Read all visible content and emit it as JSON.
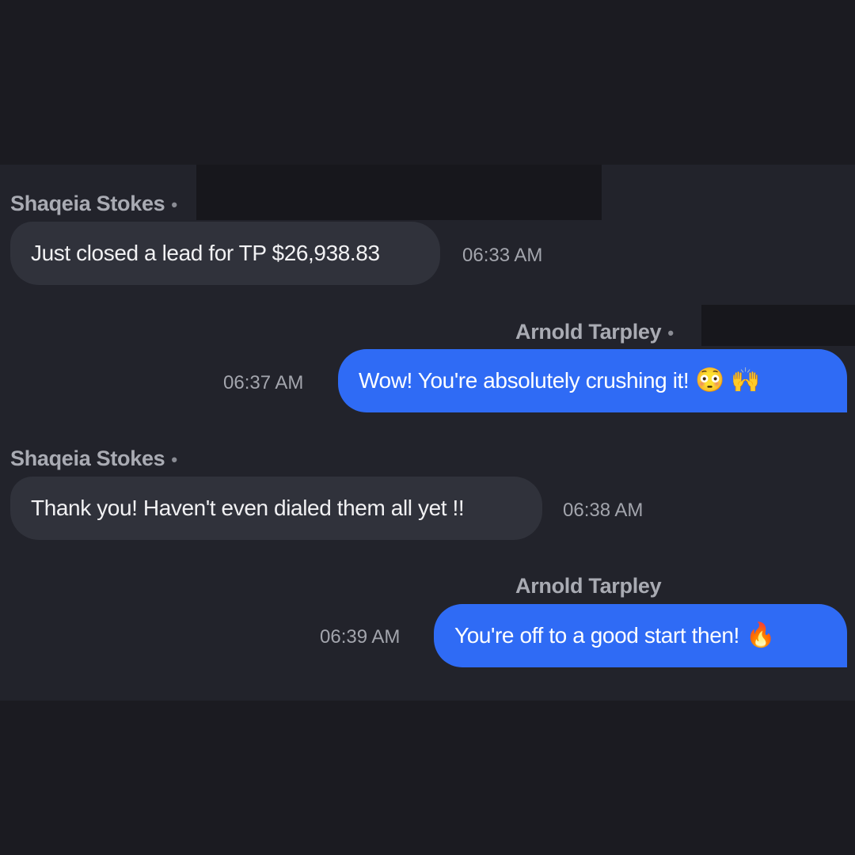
{
  "messages": [
    {
      "sender": "Shaqeia Stokes",
      "separator": "•",
      "text": "Just closed a lead for TP $26,938.83",
      "time": "06:33 AM",
      "direction": "incoming"
    },
    {
      "sender": "Arnold Tarpley",
      "separator": "•",
      "text": "Wow! You're absolutely crushing it!",
      "emojis": [
        "😳",
        "🙌"
      ],
      "emoji_icons": [
        "exploding-head-emoji-icon",
        "raising-hands-emoji-icon"
      ],
      "time": "06:37 AM",
      "direction": "outgoing"
    },
    {
      "sender": "Shaqeia Stokes",
      "separator": "•",
      "text": "Thank you! Haven't even dialed them all yet !!",
      "time": "06:38 AM",
      "direction": "incoming"
    },
    {
      "sender": "Arnold Tarpley",
      "text": "You're off to a good start then!",
      "emojis": [
        "🔥"
      ],
      "emoji_icons": [
        "fire-emoji-icon"
      ],
      "time": "06:39 AM",
      "direction": "outgoing"
    }
  ],
  "colors": {
    "page_background": "#1b1b21",
    "panel_background": "#22232b",
    "incoming_bubble": "#30323b",
    "outgoing_bubble": "#2f6bf5",
    "sender_text": "#a9abb3",
    "timestamp_text": "#a3a5ad"
  }
}
